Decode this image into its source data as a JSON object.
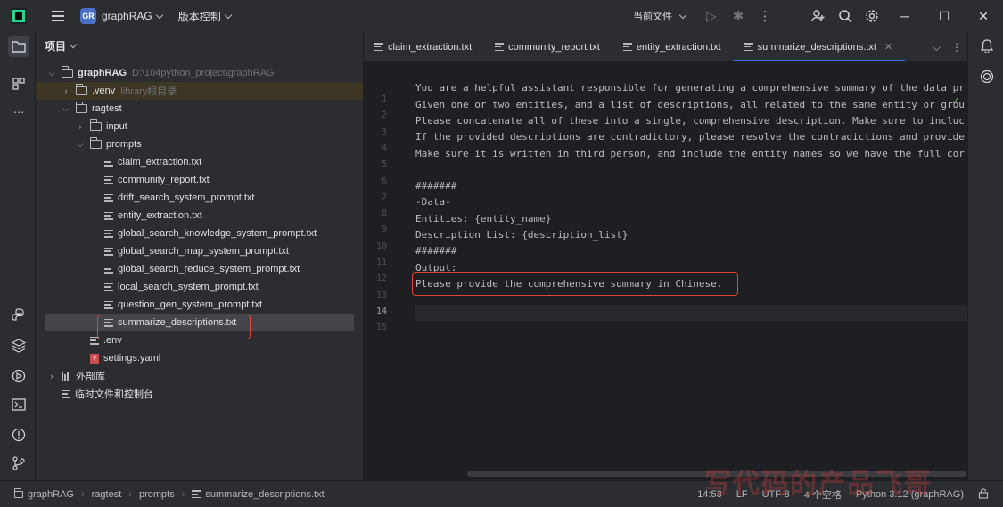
{
  "titlebar": {
    "project_badge": "GR",
    "project_name": "graphRAG",
    "vcs_label": "版本控制",
    "current_file_label": "当前文件"
  },
  "project_panel": {
    "title": "项目",
    "tree": [
      {
        "label": "graphRAG",
        "hint": "D:\\104python_project\\graphRAG",
        "kind": "folder",
        "expanded": true
      },
      {
        "label": ".venv",
        "hint": "library根目录",
        "kind": "folder",
        "expanded": false
      },
      {
        "label": "ragtest",
        "kind": "folder",
        "expanded": true
      },
      {
        "label": "input",
        "kind": "folder",
        "expanded": false
      },
      {
        "label": "prompts",
        "kind": "folder",
        "expanded": true
      },
      {
        "label": "claim_extraction.txt",
        "kind": "file"
      },
      {
        "label": "community_report.txt",
        "kind": "file"
      },
      {
        "label": "drift_search_system_prompt.txt",
        "kind": "file"
      },
      {
        "label": "entity_extraction.txt",
        "kind": "file"
      },
      {
        "label": "global_search_knowledge_system_prompt.txt",
        "kind": "file"
      },
      {
        "label": "global_search_map_system_prompt.txt",
        "kind": "file"
      },
      {
        "label": "global_search_reduce_system_prompt.txt",
        "kind": "file"
      },
      {
        "label": "local_search_system_prompt.txt",
        "kind": "file"
      },
      {
        "label": "question_gen_system_prompt.txt",
        "kind": "file"
      },
      {
        "label": "summarize_descriptions.txt",
        "kind": "file",
        "selected": true
      },
      {
        "label": ".env",
        "kind": "file"
      },
      {
        "label": "settings.yaml",
        "kind": "yaml"
      },
      {
        "label": "外部库",
        "kind": "library"
      },
      {
        "label": "临时文件和控制台",
        "kind": "scratch"
      }
    ]
  },
  "editor": {
    "tabs": [
      {
        "label": "claim_extraction.txt",
        "active": false
      },
      {
        "label": "community_report.txt",
        "active": false
      },
      {
        "label": "entity_extraction.txt",
        "active": false
      },
      {
        "label": "summarize_descriptions.txt",
        "active": true
      }
    ],
    "current_line": 14,
    "lines": [
      "",
      "You are a helpful assistant responsible for generating a comprehensive summary of the data pr",
      "Given one or two entities, and a list of descriptions, all related to the same entity or grou",
      "Please concatenate all of these into a single, comprehensive description. Make sure to incluc",
      "If the provided descriptions are contradictory, please resolve the contradictions and provide",
      "Make sure it is written in third person, and include the entity names so we have the full cor",
      "",
      "#######",
      "-Data-",
      "Entities: {entity_name}",
      "Description List: {description_list}",
      "#######",
      "Output:",
      "Please provide the comprehensive summary in Chinese.",
      ""
    ]
  },
  "statusbar": {
    "breadcrumbs": [
      "graphRAG",
      "ragtest",
      "prompts",
      "summarize_descriptions.txt"
    ],
    "position": "14:53",
    "line_separator": "LF",
    "encoding": "UTF-8",
    "indent": "4 个空格",
    "interpreter": "Python 3.12 (graphRAG)"
  },
  "watermark": "写代码的产品飞哥",
  "colors": {
    "accent": "#3574f0",
    "highlight_box": "#e0433a",
    "background": "#1e1f22",
    "panel": "#2b2d30"
  }
}
